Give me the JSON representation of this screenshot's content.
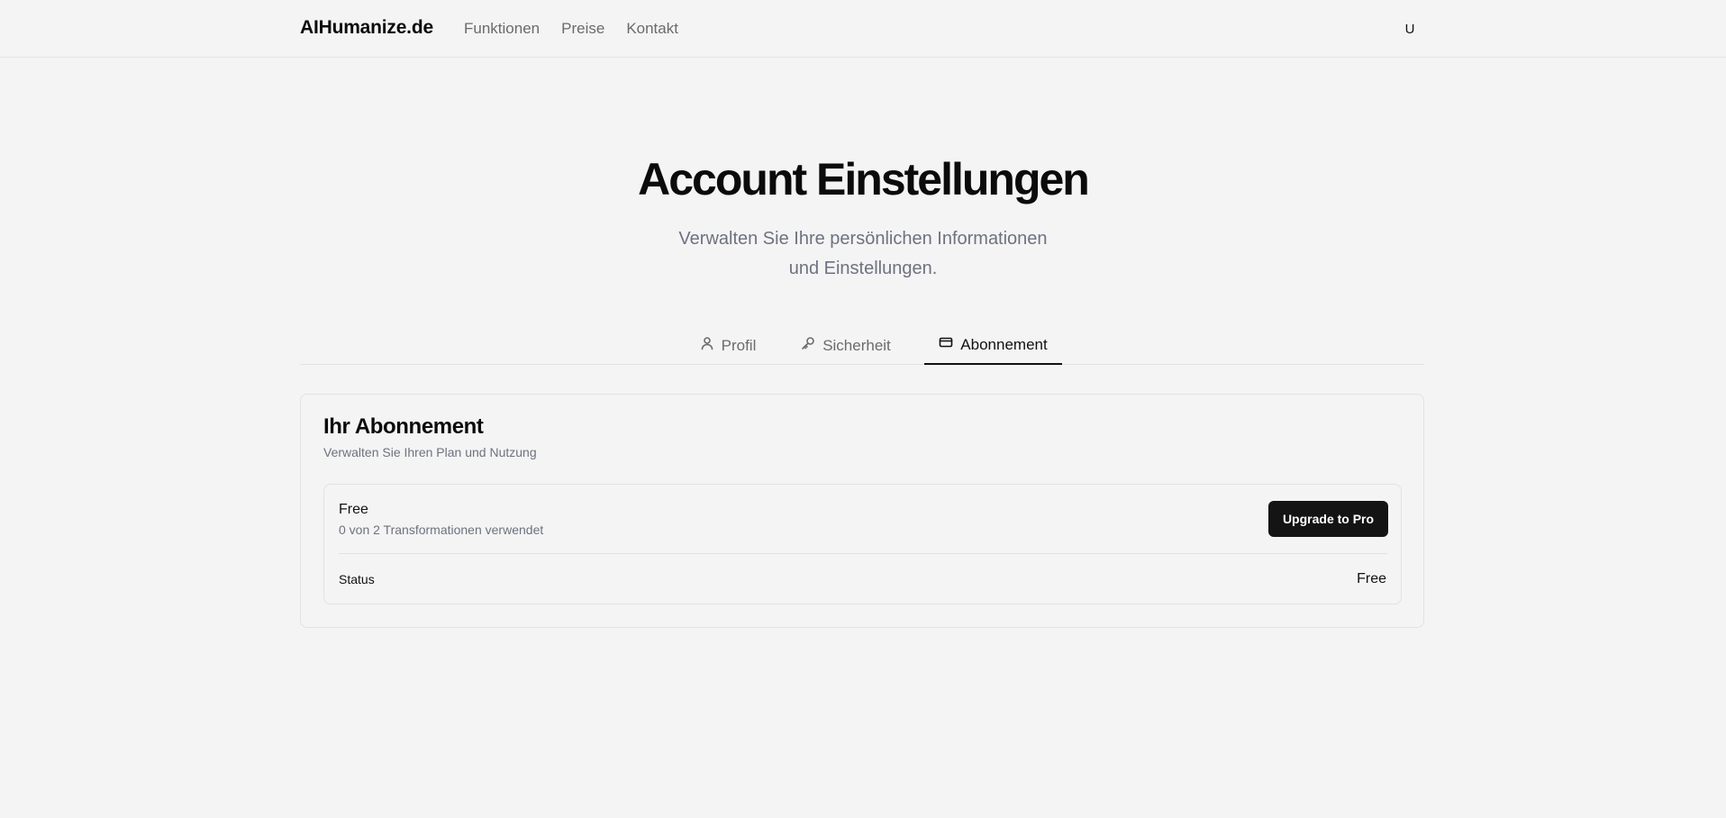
{
  "header": {
    "brand": "AIHumanize.de",
    "nav": [
      {
        "label": "Funktionen"
      },
      {
        "label": "Preise"
      },
      {
        "label": "Kontakt"
      }
    ],
    "avatar_initial": "U"
  },
  "page": {
    "title": "Account Einstellungen",
    "subtitle_line1": "Verwalten Sie Ihre persönlichen Informationen",
    "subtitle_line2": "und Einstellungen."
  },
  "tabs": [
    {
      "label": "Profil",
      "icon": "user-icon",
      "active": false
    },
    {
      "label": "Sicherheit",
      "icon": "key-icon",
      "active": false
    },
    {
      "label": "Abonnement",
      "icon": "credit-card-icon",
      "active": true
    }
  ],
  "subscription": {
    "title": "Ihr Abonnement",
    "description": "Verwalten Sie Ihren Plan und Nutzung",
    "plan_name": "Free",
    "usage": "0 von 2 Transformationen verwendet",
    "upgrade_label": "Upgrade to Pro",
    "status_label": "Status",
    "status_value": "Free"
  },
  "colors": {
    "background": "#f4f4f4",
    "primary_button": "#141414",
    "muted_text": "#6e7280",
    "border": "#e2e2e2"
  }
}
